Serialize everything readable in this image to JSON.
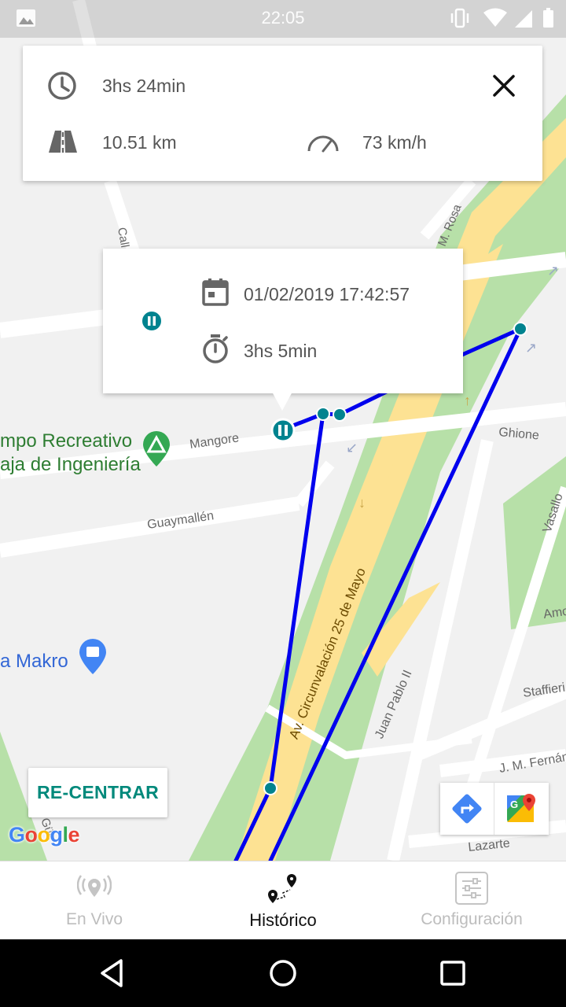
{
  "status_bar": {
    "time": "22:05"
  },
  "trip_summary": {
    "duration": "3hs 24min",
    "distance": "10.51 km",
    "max_speed": "73 km/h"
  },
  "stop_popup": {
    "datetime": "01/02/2019 17:42:57",
    "stop_duration": "3hs 5min"
  },
  "map": {
    "labels": {
      "place_1_line1": "mpo Recreativo",
      "place_1_line2": "aja de Ingeniería",
      "place_2": "a Makro",
      "street_mangore": "Mangore",
      "street_guaymallen": "Guaymallén",
      "street_ghione": "Ghione",
      "street_vasallo": "Vasallo",
      "street_circunvalacion": "Av. Circunvalación 25 de Mayo",
      "street_juan_pablo": "Juan Pablo II",
      "street_staffieri": "Staffieri",
      "street_jm_fern": "J. M. Fernán",
      "street_lazarte": "Lazarte",
      "street_m_rosa": "M. Rosa",
      "street_call": "Call",
      "street_amo": "Amo",
      "street_gue": "Güe"
    },
    "route_color": "#0000ee",
    "marker_color": "#00838f",
    "google_logo": "Google"
  },
  "recenter_button": {
    "label": "RE-CENTRAR"
  },
  "bottom_nav": {
    "items": [
      {
        "label": "En Vivo",
        "icon": "live-location-icon",
        "active": false
      },
      {
        "label": "Histórico",
        "icon": "route-history-icon",
        "active": true
      },
      {
        "label": "Configuración",
        "icon": "settings-sliders-icon",
        "active": false
      }
    ]
  }
}
